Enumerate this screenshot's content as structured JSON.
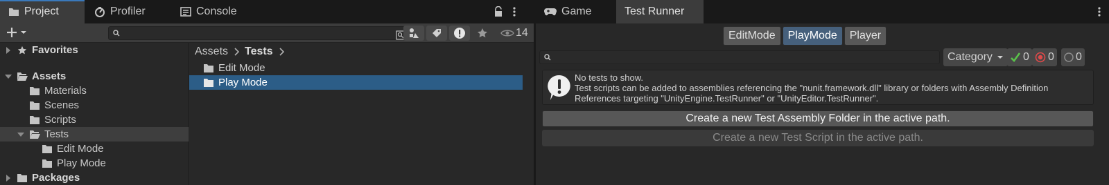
{
  "project_window": {
    "tabs": [
      {
        "label": "Project",
        "icon": "folder-icon",
        "active": true
      },
      {
        "label": "Profiler",
        "icon": "profiler-icon",
        "active": false
      },
      {
        "label": "Console",
        "icon": "console-icon",
        "active": false
      }
    ],
    "search": {
      "placeholder": "",
      "value": ""
    },
    "hidden_count": "14",
    "tree": [
      {
        "label": "Favorites",
        "depth": 0,
        "expanded": false,
        "icon": "star-icon",
        "bold": true
      },
      {
        "label": "Assets",
        "depth": 0,
        "expanded": true,
        "icon": "folder-open-icon",
        "bold": true
      },
      {
        "label": "Materials",
        "depth": 1,
        "icon": "folder-icon"
      },
      {
        "label": "Scenes",
        "depth": 1,
        "icon": "folder-icon"
      },
      {
        "label": "Scripts",
        "depth": 1,
        "icon": "folder-icon"
      },
      {
        "label": "Tests",
        "depth": 1,
        "expanded": true,
        "icon": "folder-open-icon",
        "selected": true
      },
      {
        "label": "Edit Mode",
        "depth": 2,
        "icon": "folder-icon"
      },
      {
        "label": "Play Mode",
        "depth": 2,
        "icon": "folder-icon"
      },
      {
        "label": "Packages",
        "depth": 0,
        "expanded": false,
        "icon": "folder-icon",
        "bold": true
      }
    ],
    "breadcrumb": [
      "Assets",
      "Tests"
    ],
    "content_items": [
      {
        "label": "Edit Mode",
        "selected": false
      },
      {
        "label": "Play Mode",
        "selected": true
      }
    ]
  },
  "test_runner_window": {
    "tabs": [
      {
        "label": "Game",
        "icon": "game-controller-icon",
        "active": false
      },
      {
        "label": "Test Runner",
        "active": true
      }
    ],
    "modes": [
      {
        "label": "EditMode",
        "active": false
      },
      {
        "label": "PlayMode",
        "active": true
      },
      {
        "label": "Player",
        "active": false
      }
    ],
    "search": {
      "placeholder": "",
      "value": ""
    },
    "category_label": "Category",
    "passed_count": "0",
    "failed_count": "0",
    "skipped_count": "0",
    "info": {
      "title": "No tests to show.",
      "line1": "Test scripts can be added to assemblies referencing the \"nunit.framework.dll\" library or folders with Assembly Definition",
      "line2": "References targeting \"UnityEngine.TestRunner\" or \"UnityEditor.TestRunner\"."
    },
    "create_folder_label": "Create a new Test Assembly Folder in the active path.",
    "create_script_label": "Create a new Test Script in the active path."
  },
  "colors": {
    "selection": "#2c5d87",
    "pass": "#5ac24a",
    "fail": "#e04a4a",
    "active_mode": "#46607c"
  }
}
